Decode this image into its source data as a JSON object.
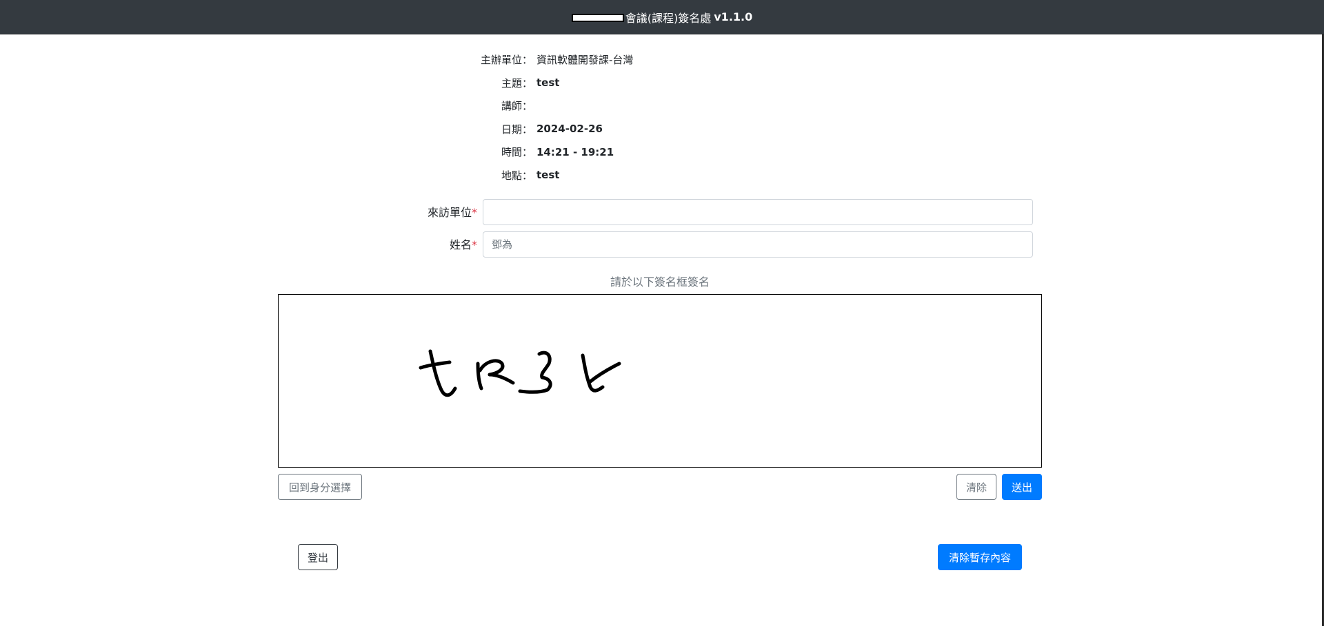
{
  "header": {
    "title": "會議(課程)簽名處",
    "version": "v1.1.0"
  },
  "info": {
    "rows": [
      {
        "label": "主辦單位：",
        "value": "資訊軟體開發課-台灣"
      },
      {
        "label": "主題：",
        "value": "test"
      },
      {
        "label": "講師：",
        "value": ""
      },
      {
        "label": "日期：",
        "value": "2024-02-26"
      },
      {
        "label": "時間：",
        "value": "14:21 - 19:21"
      },
      {
        "label": "地點：",
        "value": "test"
      }
    ]
  },
  "form": {
    "visiting_unit": {
      "label": "來訪單位",
      "required_mark": "*",
      "value": "",
      "placeholder": ""
    },
    "name": {
      "label": "姓名",
      "required_mark": "*",
      "value": "",
      "placeholder": "鄧為"
    }
  },
  "signature": {
    "hint": "請於以下簽名框簽名"
  },
  "buttons": {
    "back": "回到身分選擇",
    "clear": "清除",
    "submit": "送出",
    "logout": "登出",
    "clear_cache": "清除暫存內容"
  },
  "colors": {
    "header_bg": "#343a40",
    "primary": "#007bff",
    "required": "#dc3545"
  }
}
